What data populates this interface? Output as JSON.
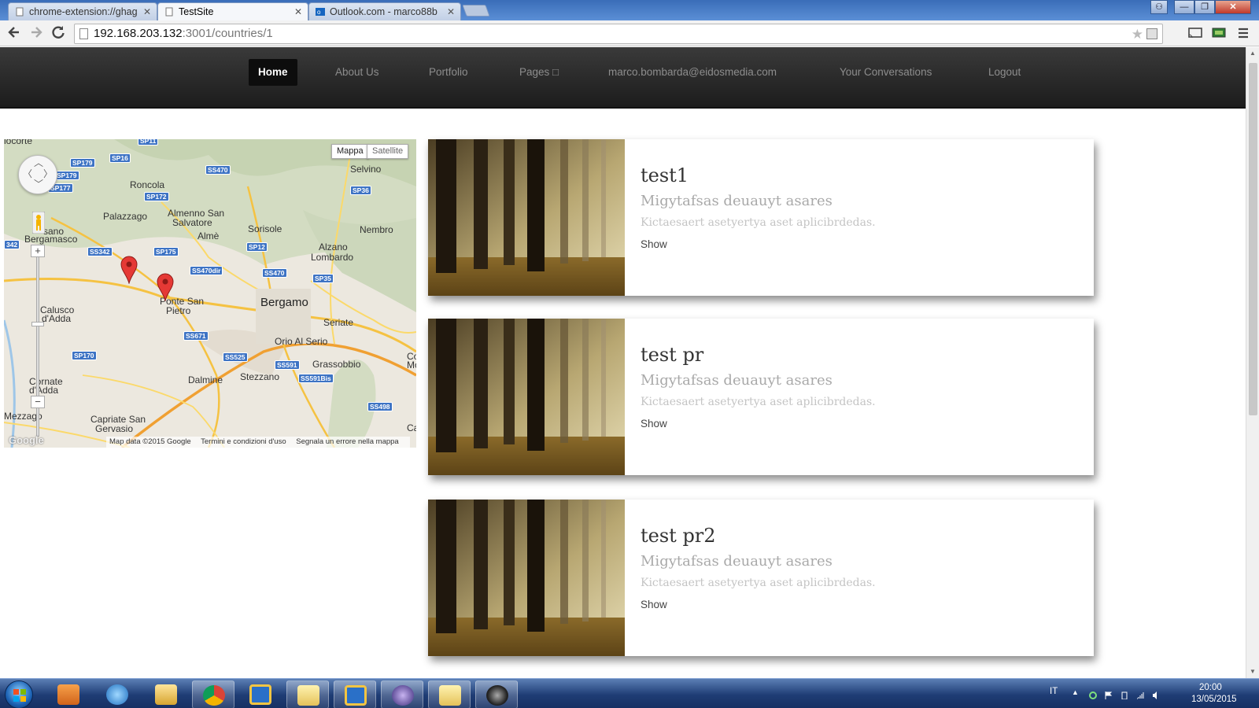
{
  "browser": {
    "tabs": [
      {
        "title": "chrome-extension://ghag",
        "active": false,
        "icon": "page-icon"
      },
      {
        "title": "TestSite",
        "active": true,
        "icon": "page-icon"
      },
      {
        "title": "Outlook.com - marco88b",
        "active": false,
        "icon": "outlook-icon"
      }
    ],
    "tab_close_glyph": "✕",
    "address": {
      "host": "192.168.203.132",
      "path": ":3001/countries/1"
    },
    "window_controls": {
      "minimize": "—",
      "maximize": "❐",
      "close": "✕"
    }
  },
  "site_nav": {
    "items": [
      {
        "label": "Home",
        "active": true
      },
      {
        "label": "About Us",
        "active": false
      },
      {
        "label": "Portfolio",
        "active": false
      },
      {
        "label": "Pages □",
        "active": false
      },
      {
        "label": "marco.bombarda@eidosmedia.com",
        "active": false
      },
      {
        "label": "Your Conversations",
        "active": false
      },
      {
        "label": "Logout",
        "active": false
      }
    ]
  },
  "map": {
    "type_buttons": {
      "map": "Mappa",
      "satellite": "Satellite"
    },
    "cities": [
      "Bergamo"
    ],
    "places": [
      "locorte",
      "Roncola",
      "Selvino",
      "Palazzago",
      "Almenno San",
      "Salvatore",
      "Almè",
      "Sorisole",
      "Nembro",
      "Alzano",
      "Lombardo",
      "sano",
      "Bergamasco",
      "Ponte San",
      "Pietro",
      "Calusco",
      "d'Adda",
      "Seriate",
      "Orio Al Serio",
      "Grassobbio",
      "Dalmine",
      "Stezzano",
      "Cornate",
      "d'Adda",
      "Mezzago",
      "Capriate San",
      "Gervasio",
      "Ca",
      "Co",
      "Mo"
    ],
    "road_shields": [
      "SP11",
      "SP179",
      "SP16",
      "SP179",
      "SP177",
      "SS470",
      "SP172",
      "SP36",
      "342",
      "SS342",
      "SP175",
      "SP12",
      "SS470dir",
      "SS470",
      "SP35",
      "SS671",
      "SP170",
      "SS525",
      "SS591",
      "SS591Bis",
      "SS498"
    ],
    "footer": {
      "data": "Map data ©2015 Google",
      "terms": "Termini e condizioni d'uso",
      "report": "Segnala un errore nella mappa"
    },
    "google_logo": "Google",
    "zoom_in": "+",
    "zoom_out": "−"
  },
  "cards": [
    {
      "title": "test1",
      "subtitle": "Migytafsas deuauyt asares",
      "description": "Kictaesaert asetyertya aset aplicibrdedas.",
      "link": "Show"
    },
    {
      "title": "test pr",
      "subtitle": "Migytafsas deuauyt asares",
      "description": "Kictaesaert asetyertya aset aplicibrdedas.",
      "link": "Show"
    },
    {
      "title": "test pr2",
      "subtitle": "Migytafsas deuauyt asares",
      "description": "Kictaesaert asetyertya aset aplicibrdedas.",
      "link": "Show"
    }
  ],
  "taskbar": {
    "apps": [
      "media-player-icon",
      "internet-explorer-icon",
      "file-explorer-icon",
      "chrome-icon",
      "vm-icon",
      "folder-icon",
      "vm-icon",
      "eclipse-icon",
      "folder-icon",
      "camera-icon"
    ],
    "language": "IT",
    "time": "20:00",
    "date": "13/05/2015"
  },
  "colors": {
    "nav_bg": "#222222",
    "nav_active": "#0d0d0d",
    "map_marker": "#e53935",
    "taskbar": "#1f3d75"
  }
}
